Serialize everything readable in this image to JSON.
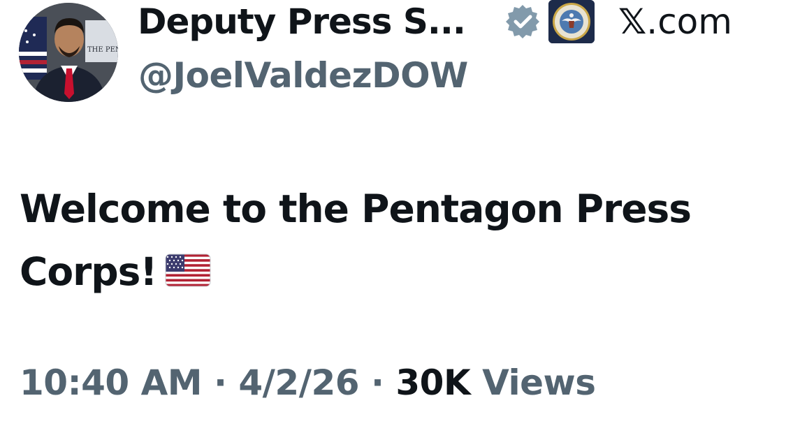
{
  "author": {
    "display_name": "Deputy Press S...",
    "handle": "@JoelValdezDOW",
    "avatar_text": "THE PEN"
  },
  "header": {
    "site_label": ".com",
    "x_logo": "𝕏"
  },
  "tweet": {
    "text": "Welcome to the Pentagon Press Corps!",
    "emoji": "us-flag-emoji"
  },
  "meta": {
    "time": "10:40 AM",
    "separator": "·",
    "date": "4/2/26",
    "views_count": "30K",
    "views_label": "Views"
  },
  "colors": {
    "primary_text": "#0f1419",
    "secondary_text": "#536471",
    "verified_badge": "#829aab"
  }
}
